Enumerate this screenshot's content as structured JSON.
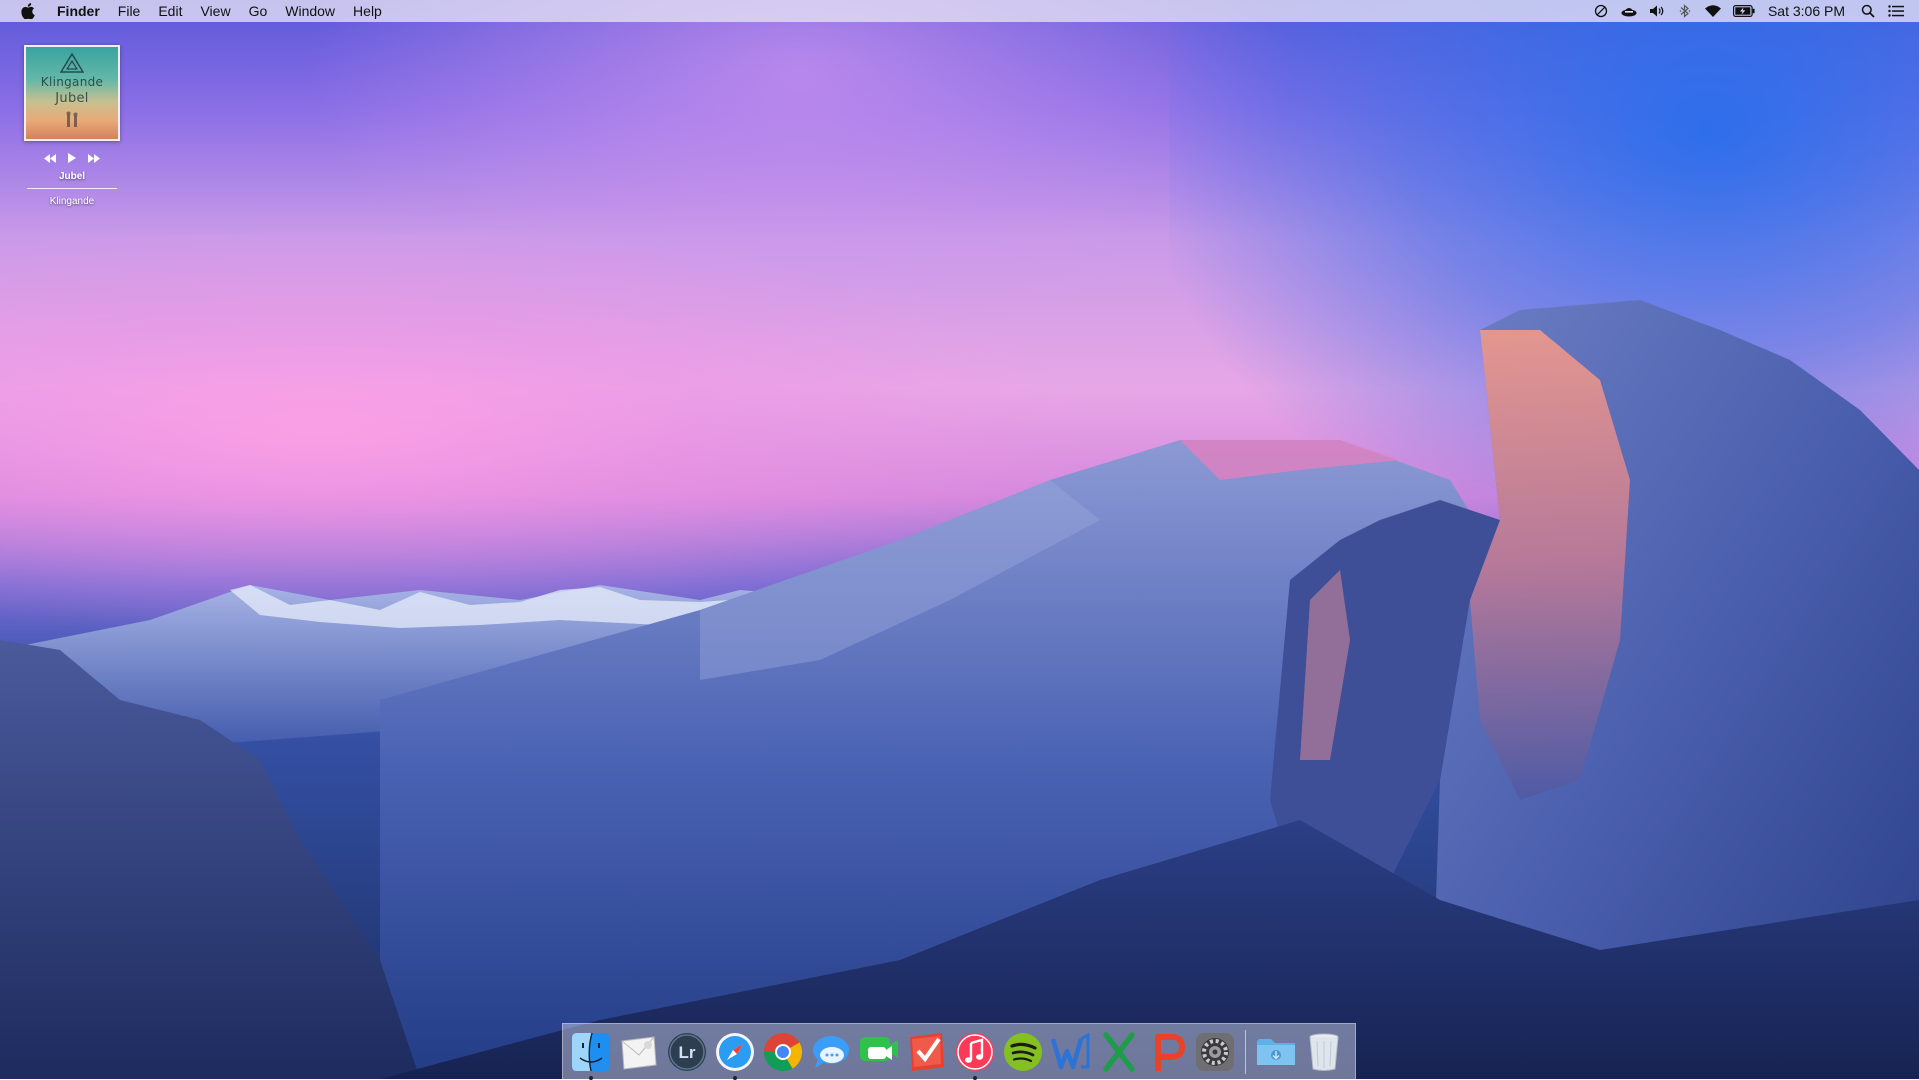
{
  "menubar": {
    "apple_icon": "apple-logo-icon",
    "app_name": "Finder",
    "menus": [
      "File",
      "Edit",
      "View",
      "Go",
      "Window",
      "Help"
    ],
    "status_icons": [
      "do-not-disturb-icon",
      "lock-hat-icon",
      "volume-icon",
      "bluetooth-icon",
      "wifi-icon",
      "battery-icon"
    ],
    "clock": "Sat 3:06 PM",
    "right_icons": [
      "spotlight-icon",
      "notification-center-icon"
    ]
  },
  "music_widget": {
    "album_artist": "Klingande",
    "album_title": "Jubel",
    "track_title": "Jubel",
    "track_artist": "Klingande",
    "controls": [
      "rewind-icon",
      "play-icon",
      "fast-forward-icon"
    ]
  },
  "dock": {
    "apps": [
      {
        "name": "Finder",
        "icon": "finder-icon",
        "running": true
      },
      {
        "name": "Mail",
        "icon": "mail-icon",
        "running": false
      },
      {
        "name": "Lightroom",
        "icon": "lightroom-icon",
        "label": "Lr",
        "running": false
      },
      {
        "name": "Safari",
        "icon": "safari-icon",
        "running": true
      },
      {
        "name": "Chrome",
        "icon": "chrome-icon",
        "running": false
      },
      {
        "name": "Messages",
        "icon": "messages-icon",
        "running": false
      },
      {
        "name": "FaceTime",
        "icon": "facetime-icon",
        "running": false
      },
      {
        "name": "Wunderlist",
        "icon": "wunderlist-icon",
        "running": false
      },
      {
        "name": "iTunes",
        "icon": "itunes-icon",
        "running": true
      },
      {
        "name": "Spotify",
        "icon": "spotify-icon",
        "running": false
      },
      {
        "name": "Word",
        "icon": "word-icon",
        "running": false
      },
      {
        "name": "Excel",
        "icon": "excel-icon",
        "running": false
      },
      {
        "name": "PowerPoint",
        "icon": "powerpoint-icon",
        "running": false
      },
      {
        "name": "System Preferences",
        "icon": "system-preferences-icon",
        "running": false
      }
    ],
    "stacks": [
      {
        "name": "Downloads",
        "icon": "downloads-folder-icon"
      },
      {
        "name": "Trash",
        "icon": "trash-icon"
      }
    ]
  }
}
